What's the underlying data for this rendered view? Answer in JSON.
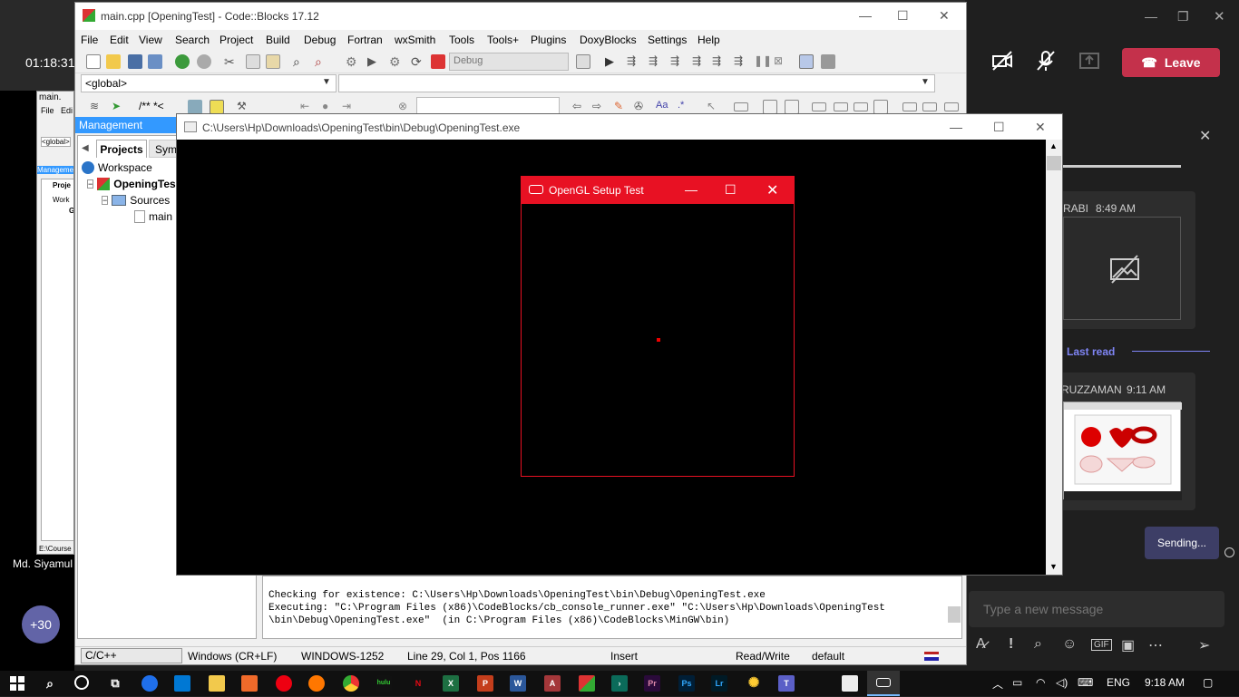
{
  "teams": {
    "timer": "01:18:31",
    "leave_label": "Leave",
    "participant_name": "Md. Siyamul",
    "more_participants": "+30",
    "chat": {
      "msg1_sender": "RABI",
      "msg1_time": "8:49 AM",
      "last_read": "Last read",
      "msg2_sender": "RUZZAMAN",
      "msg2_time": "9:11 AM",
      "sending": "Sending...",
      "input_placeholder": "Type a new message"
    }
  },
  "codeblocks": {
    "title": "main.cpp [OpeningTest] - Code::Blocks 17.12",
    "menu": [
      "File",
      "Edit",
      "View",
      "Search",
      "Project",
      "Build",
      "Debug",
      "Fortran",
      "wxSmith",
      "Tools",
      "Tools+",
      "Plugins",
      "DoxyBlocks",
      "Settings",
      "Help"
    ],
    "build_target": "Debug",
    "scope": "<global>",
    "comment_button": "/** *<",
    "management": {
      "title": "Management",
      "tab_projects": "Projects",
      "tab_symbols": "Syml",
      "tree": {
        "workspace": "Workspace",
        "project": "OpeningTes",
        "sources": "Sources",
        "file": "main"
      }
    },
    "log_lines": [
      "Checking for existence: C:\\Users\\Hp\\Downloads\\OpeningTest\\bin\\Debug\\OpeningTest.exe",
      "Executing: \"C:\\Program Files (x86)\\CodeBlocks/cb_console_runner.exe\" \"C:\\Users\\Hp\\Downloads\\OpeningTest",
      "\\bin\\Debug\\OpeningTest.exe\"  (in C:\\Program Files (x86)\\CodeBlocks\\MinGW\\bin)"
    ],
    "status": {
      "language": "C/C++",
      "line_endings": "Windows (CR+LF)",
      "encoding": "WINDOWS-1252",
      "position": "Line 29, Col 1, Pos 1166",
      "mode": "Insert",
      "access": "Read/Write",
      "profile": "default"
    },
    "mini": {
      "title": "main.",
      "menu_file": "File",
      "menu_edit": "Edi",
      "scope": "<global>",
      "management": "Manageme",
      "tab": "Proje",
      "tree_workspace": "Work",
      "tree_g": "G",
      "path": "E:\\Course"
    }
  },
  "console": {
    "title": "C:\\Users\\Hp\\Downloads\\OpeningTest\\bin\\Debug\\OpeningTest.exe"
  },
  "gl_window": {
    "title": "OpenGL Setup Test",
    "accent": "#e81123"
  },
  "taskbar": {
    "language": "ENG",
    "time": "9:18 AM"
  }
}
